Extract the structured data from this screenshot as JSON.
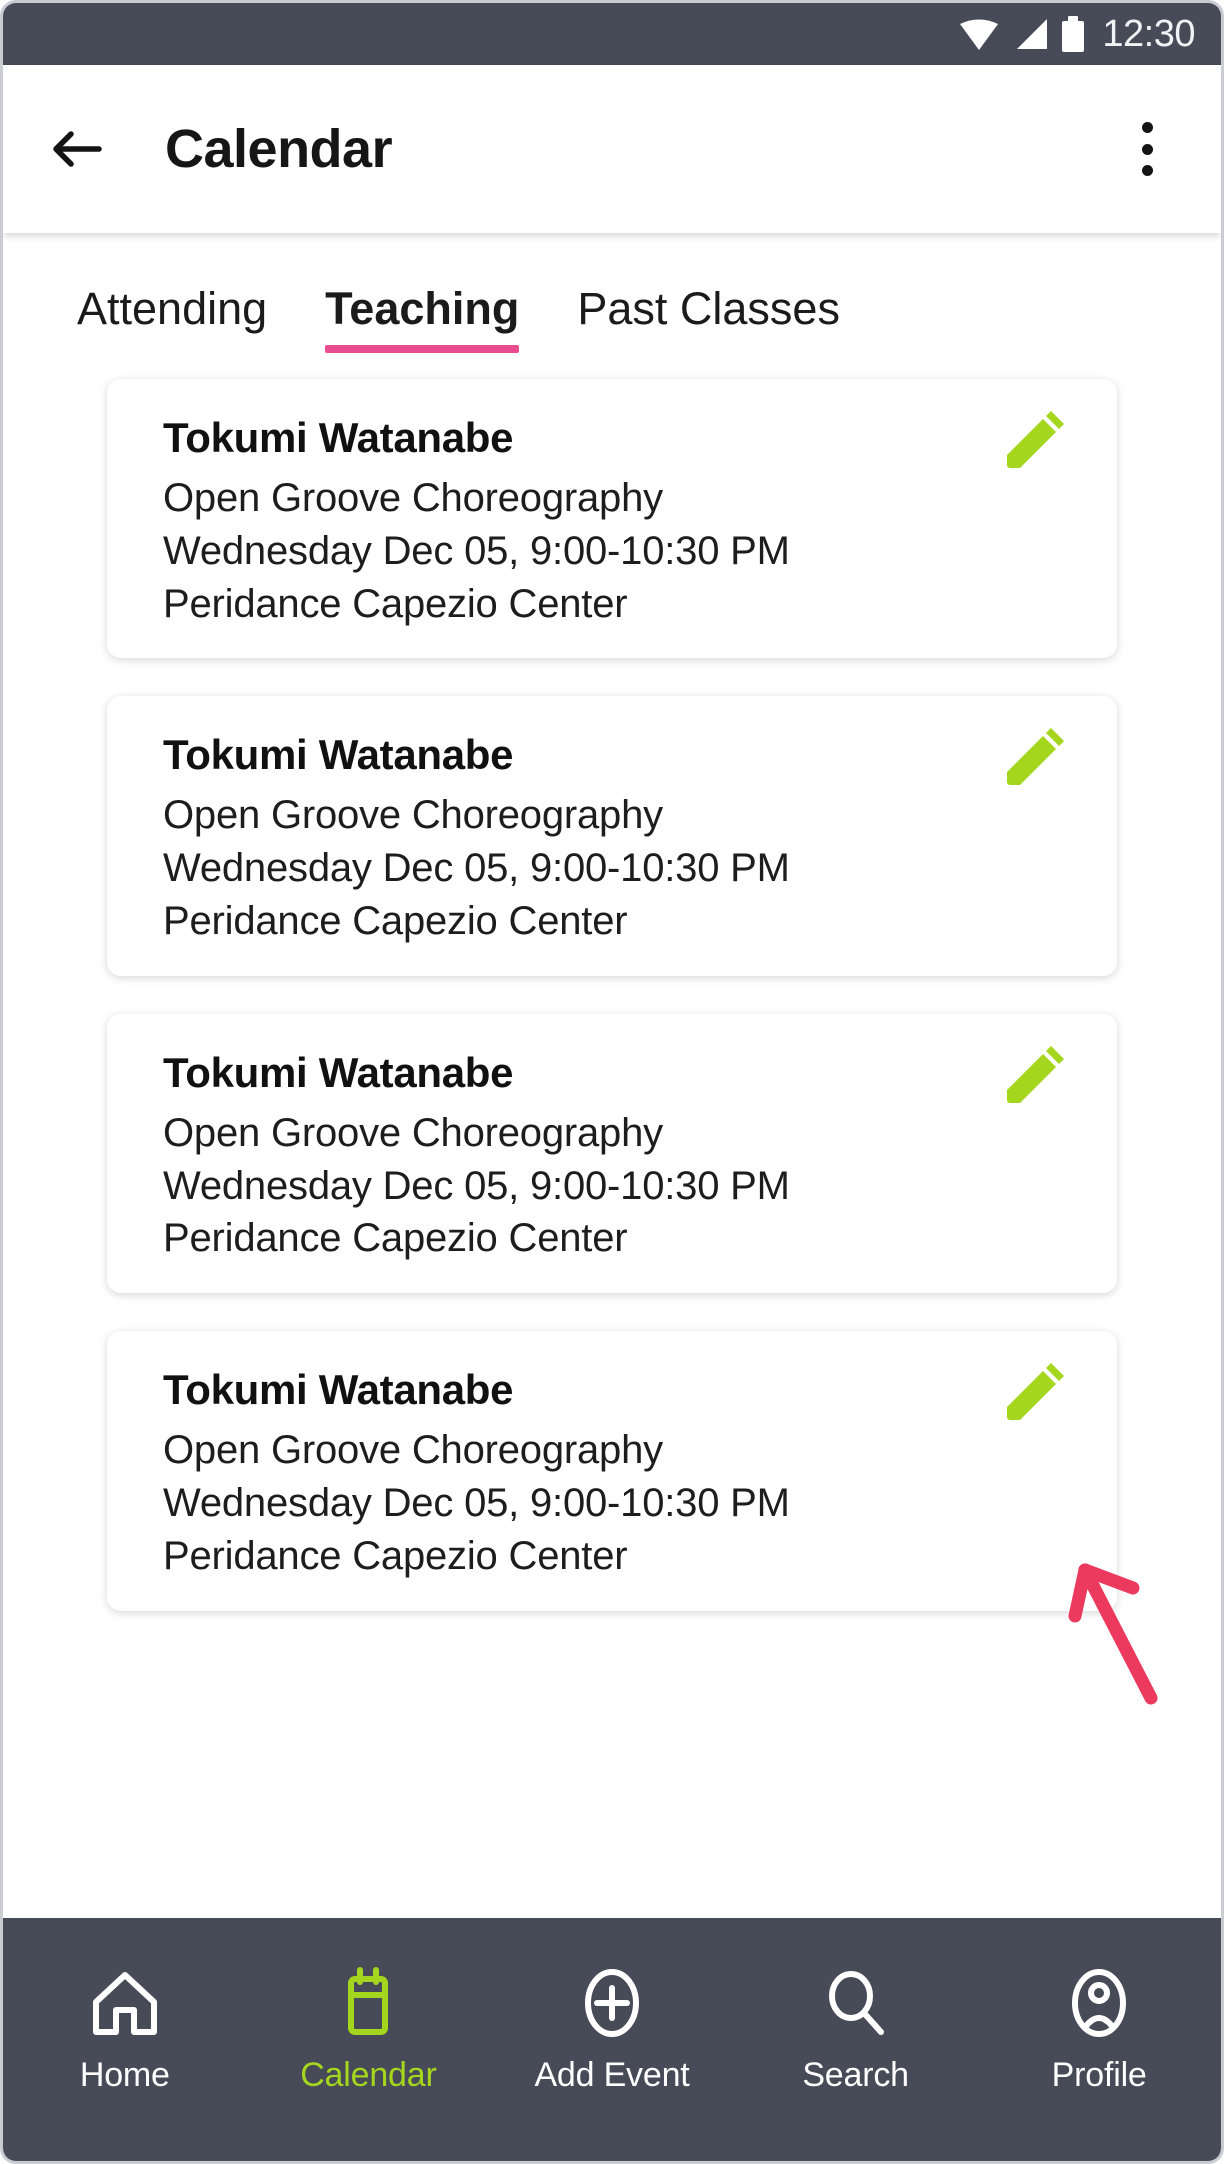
{
  "statusbar": {
    "time": "12:30",
    "icons": [
      "wifi-icon",
      "cellular-signal-icon",
      "battery-icon"
    ],
    "background_color": "#474a57"
  },
  "appbar": {
    "title": "Calendar",
    "back_icon": "back-arrow-icon",
    "overflow_icon": "more-vertical-icon"
  },
  "tabs": {
    "items": [
      {
        "label": "Attending",
        "active": false
      },
      {
        "label": "Teaching",
        "active": true
      },
      {
        "label": "Past Classes",
        "active": false
      }
    ],
    "active_indicator_color": "#e84d8f"
  },
  "cards": [
    {
      "instructor": "Tokumi Watanabe",
      "class_name": "Open Groove Choreography",
      "schedule": "Wednesday Dec 05, 9:00-10:30 PM",
      "venue": "Peridance Capezio Center",
      "edit_icon": "pencil-edit-icon"
    },
    {
      "instructor": "Tokumi Watanabe",
      "class_name": "Open Groove Choreography",
      "schedule": "Wednesday Dec 05, 9:00-10:30 PM",
      "venue": "Peridance Capezio Center",
      "edit_icon": "pencil-edit-icon"
    },
    {
      "instructor": "Tokumi Watanabe",
      "class_name": "Open Groove Choreography",
      "schedule": "Wednesday Dec 05, 9:00-10:30 PM",
      "venue": "Peridance Capezio Center",
      "edit_icon": "pencil-edit-icon"
    },
    {
      "instructor": "Tokumi Watanabe",
      "class_name": "Open Groove Choreography",
      "schedule": "Wednesday Dec 05, 9:00-10:30 PM",
      "venue": "Peridance Capezio Center",
      "edit_icon": "pencil-edit-icon"
    }
  ],
  "annotation": {
    "type": "arrow",
    "color": "#ec3a5e",
    "points_to": "pencil-edit-icon on fourth card"
  },
  "bottomnav": {
    "background_color": "#474a57",
    "active_color": "#a5d61e",
    "items": [
      {
        "label": "Home",
        "icon": "home-icon",
        "active": false
      },
      {
        "label": "Calendar",
        "icon": "calendar-icon",
        "active": true
      },
      {
        "label": "Add Event",
        "icon": "plus-circle-icon",
        "active": false
      },
      {
        "label": "Search",
        "icon": "search-icon",
        "active": false
      },
      {
        "label": "Profile",
        "icon": "profile-icon",
        "active": false
      }
    ]
  },
  "colors": {
    "accent_pink": "#e84d8f",
    "accent_green": "#a5d61e",
    "annotation_red": "#ec3a5e",
    "chrome_dark": "#474a57"
  }
}
